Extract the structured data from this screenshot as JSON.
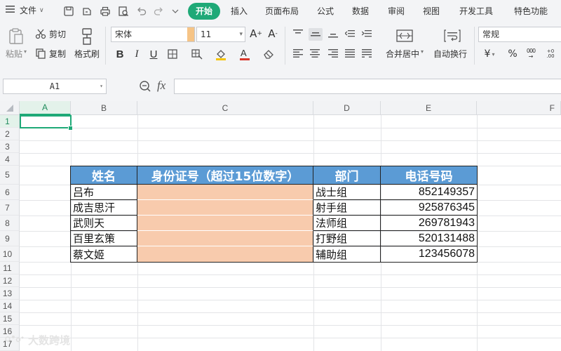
{
  "menu": {
    "file_label": "文件",
    "tabs": [
      "开始",
      "插入",
      "页面布局",
      "公式",
      "数据",
      "审阅",
      "视图",
      "开发工具",
      "特色功能"
    ],
    "active_tab": "开始"
  },
  "ribbon": {
    "paste": "粘贴",
    "cut": "剪切",
    "copy": "复制",
    "format_painter": "格式刷",
    "font_name": "宋体",
    "font_size": "11",
    "merge_center": "合并居中",
    "wrap_text": "自动换行",
    "number_format": "常规"
  },
  "formula_bar": {
    "name_box": "A1",
    "fx": "fx",
    "value": ""
  },
  "sheet": {
    "columns": [
      "A",
      "B",
      "C",
      "D",
      "E",
      "F"
    ],
    "rows": [
      "1",
      "2",
      "3",
      "4",
      "5",
      "6",
      "7",
      "8",
      "9",
      "10",
      "11",
      "12",
      "13",
      "14",
      "15",
      "16",
      "17"
    ],
    "table_header": [
      "姓名",
      "身份证号（超过15位数字）",
      "部门",
      "电话号码"
    ],
    "table_rows": [
      {
        "name": "吕布",
        "id": "",
        "dept": "战士组",
        "phone": "852149357"
      },
      {
        "name": "成吉思汗",
        "id": "",
        "dept": "射手组",
        "phone": "925876345"
      },
      {
        "name": "武则天",
        "id": "",
        "dept": "法师组",
        "phone": "269781943"
      },
      {
        "name": "百里玄策",
        "id": "",
        "dept": "打野组",
        "phone": "520131488"
      },
      {
        "name": "蔡文姬",
        "id": "",
        "dept": "辅助组",
        "phone": "123456078"
      }
    ],
    "header_fill": "#5b9bd5",
    "id_fill": "#f8cbad",
    "selection_color": "#1ea977"
  },
  "watermark": "大数跨境"
}
